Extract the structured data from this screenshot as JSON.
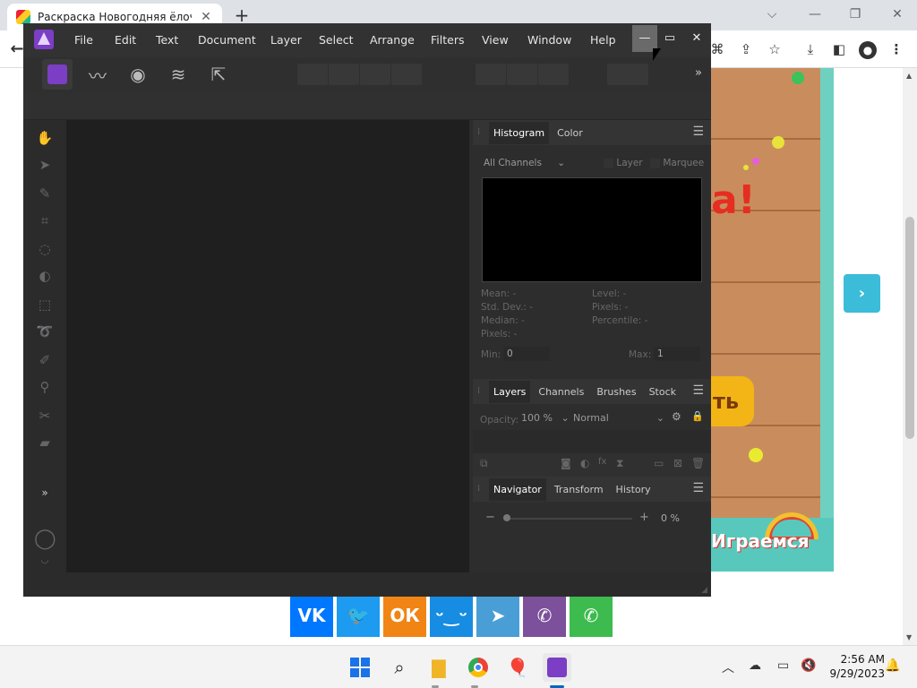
{
  "browser": {
    "tab_title": "Раскраска Новогодняя ёлочка",
    "tab_close": "✕",
    "new_tab": "+",
    "controls": {
      "chevron": "⌵",
      "minimize": "—",
      "restore": "❐",
      "close": "✕"
    }
  },
  "page": {
    "game_heading_fragment": "a!",
    "game_button_fragment": "ть",
    "game_logo": "Играемся",
    "next_arrow": "›",
    "social": [
      {
        "name": "vk",
        "label": "VK",
        "color": "#0077ff"
      },
      {
        "name": "twitter",
        "label": "🐦",
        "color": "#1d9bf0"
      },
      {
        "name": "odnoklassniki",
        "label": "ОК",
        "color": "#f08515"
      },
      {
        "name": "moimir",
        "label": "ᵕ‿ᵕ",
        "color": "#168de2"
      },
      {
        "name": "telegram",
        "label": "➤",
        "color": "#4a9ed6"
      },
      {
        "name": "viber",
        "label": "✆",
        "color": "#7c509a"
      },
      {
        "name": "whatsapp",
        "label": "✆",
        "color": "#3dbb4f"
      }
    ]
  },
  "affinity": {
    "menus": [
      "File",
      "Edit",
      "Text",
      "Document",
      "Layer",
      "Select",
      "Arrange",
      "Filters",
      "View",
      "Window",
      "Help"
    ],
    "window_controls": {
      "minimize": "—",
      "maximize": "▭",
      "close": "✕"
    },
    "overflow": "»",
    "tools_more": "»",
    "histogram_panel": {
      "tabs": [
        "Histogram",
        "Color"
      ],
      "channel": "All Channels",
      "layer_check": "Layer",
      "marquee_check": "Marquee",
      "stats_left": [
        "Mean: -",
        "Std. Dev.: -",
        "Median: -",
        "Pixels: -"
      ],
      "stats_right": [
        "Level: -",
        "Pixels: -",
        "Percentile: -"
      ],
      "min_label": "Min:",
      "min_value": "0",
      "max_label": "Max:",
      "max_value": "1"
    },
    "layers_panel": {
      "tabs": [
        "Layers",
        "Channels",
        "Brushes",
        "Stock"
      ],
      "opacity_label": "Opacity:",
      "opacity_value": "100 %",
      "blend_mode": "Normal"
    },
    "navigator_panel": {
      "tabs": [
        "Navigator",
        "Transform",
        "History"
      ],
      "zoom": "0 %",
      "minus": "−",
      "plus": "+"
    }
  },
  "taskbar": {
    "time": "2:56 AM",
    "date": "9/29/2023"
  }
}
